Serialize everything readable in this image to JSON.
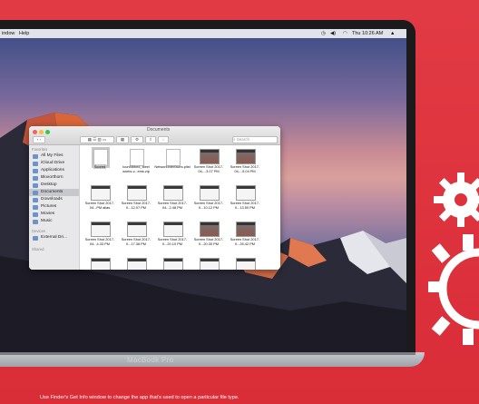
{
  "menubar": {
    "items": [
      "indow",
      "Help"
    ],
    "clock": "Thu 10:26 AM"
  },
  "finder": {
    "window_title": "Documents",
    "search_placeholder": "Search",
    "sidebar": {
      "favorites_heading": "Favorites",
      "favorites": [
        "All My Files",
        "iCloud Drive",
        "Applications",
        "Bloxorthorn",
        "Desktop",
        "Documents",
        "Downloads",
        "Pictures",
        "Movies",
        "Music"
      ],
      "devices_heading": "Devices",
      "devices": [
        "External Dri..."
      ],
      "shared_heading": "Shared"
    },
    "files": [
      {
        "name": "Scored",
        "kind": "doc"
      },
      {
        "name": "Icunfdbbed_steel works-v...ems.zip",
        "kind": "doc"
      },
      {
        "name": "NetworkInterfaces.plist",
        "kind": "doc"
      },
      {
        "name": "Screen Shot 2017-04-...3.07 PM",
        "kind": "dark"
      },
      {
        "name": "Screen Shot 2017-04-...5.04 PM",
        "kind": "dark"
      },
      {
        "name": "Screen Shot 2017-04...PM alias",
        "kind": "shot"
      },
      {
        "name": "Screen Shot 2017-0...12.07 PM",
        "kind": "shot"
      },
      {
        "name": "Screen Shot 2017-04...2.48 PM",
        "kind": "shot"
      },
      {
        "name": "Screen Shot 2017-0...10.12 PM",
        "kind": "shot"
      },
      {
        "name": "Screen Shot 2017-0...13.50 PM",
        "kind": "shot"
      },
      {
        "name": "Screen Shot 2017-04...4.33 PM",
        "kind": "shot"
      },
      {
        "name": "Screen Shot 2017-0...17.36 PM",
        "kind": "shot"
      },
      {
        "name": "Screen Shot 2017-0...20.10 PM",
        "kind": "shot"
      },
      {
        "name": "Screen Shot 2017-0...20.30 PM",
        "kind": "dark"
      },
      {
        "name": "Screen Shot 2017-0...26.42 PM",
        "kind": "dark"
      }
    ]
  },
  "laptop": {
    "brand": "MacBook Pro"
  },
  "caption": "Use Finder's Get Info window to change the app that's used to open a particular file type.",
  "colors": {
    "background": "#e0303a",
    "selection": "#c7c7cc"
  }
}
